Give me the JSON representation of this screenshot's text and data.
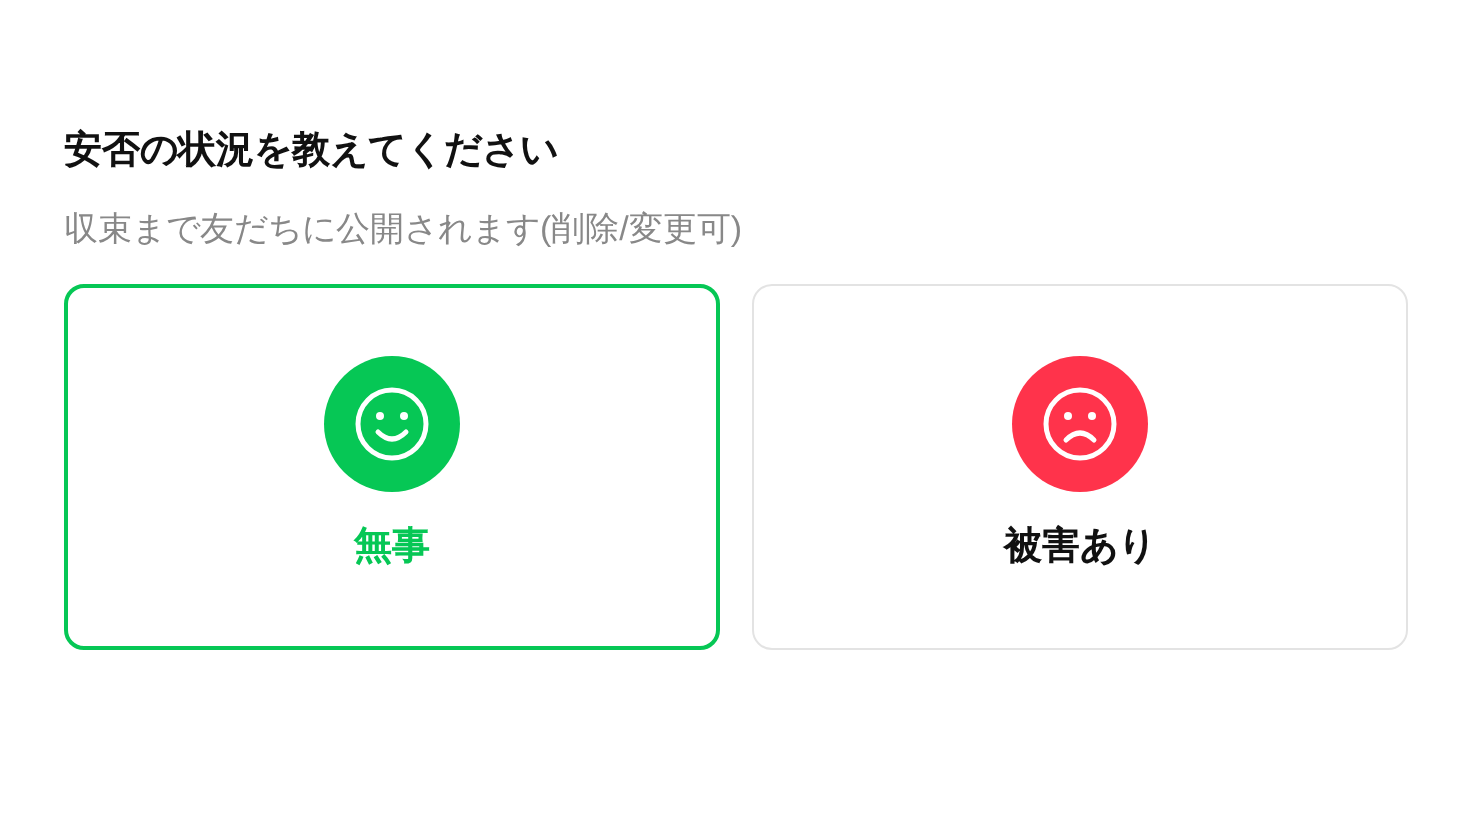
{
  "title": "安否の状況を教えてください",
  "subtitle": "収束まで友だちに公開されます(削除/変更可)",
  "options": [
    {
      "label": "無事",
      "kind": "safe",
      "selected": true
    },
    {
      "label": "被害あり",
      "kind": "damaged",
      "selected": false
    }
  ]
}
